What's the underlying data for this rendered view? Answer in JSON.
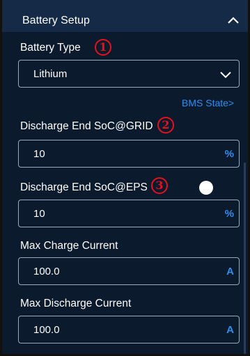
{
  "section": {
    "title": "Battery Setup"
  },
  "battery_type": {
    "label": "Battery Type",
    "marker": "1",
    "value": "Lithium"
  },
  "bms_link": "BMS State>",
  "discharge_grid": {
    "label": "Discharge End SoC@GRID",
    "marker": "2",
    "value": "10",
    "unit": "%"
  },
  "discharge_eps": {
    "label": "Discharge End SoC@EPS",
    "marker": "3",
    "value": "10",
    "unit": "%"
  },
  "max_charge": {
    "label": "Max Charge Current",
    "value": "100.0",
    "unit": "A"
  },
  "max_discharge": {
    "label": "Max Discharge Current",
    "value": "100.0",
    "unit": "A"
  },
  "colors": {
    "background": "#0c1a2e",
    "header": "#142a46",
    "accent": "#2c8ef0",
    "marker": "#e8101c"
  }
}
